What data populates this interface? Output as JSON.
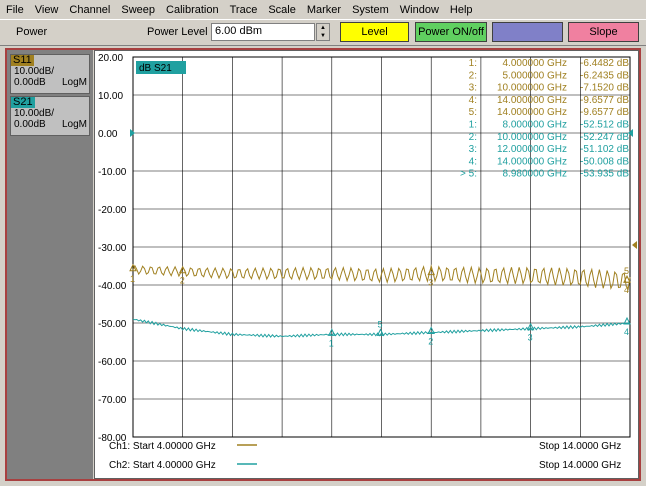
{
  "menu": [
    "File",
    "View",
    "Channel",
    "Sweep",
    "Calibration",
    "Trace",
    "Scale",
    "Marker",
    "System",
    "Window",
    "Help"
  ],
  "toolbar": {
    "mode": "Power",
    "power_label": "Power Level",
    "power_value": "6.00 dBm",
    "level_btn": "Level",
    "power_onoff_btn": "Power ON/off",
    "slope_btn": "Slope"
  },
  "colors": {
    "s11": "#a08020",
    "s21": "#20a0a0",
    "level": "#ffff00",
    "power": "#60d060",
    "blank": "#8080c8",
    "slope": "#f080a0"
  },
  "traces": [
    {
      "name": "S11",
      "scale": "10.00dB/",
      "ref": "0.00dB",
      "format": "LogM"
    },
    {
      "name": "S21",
      "scale": "10.00dB/",
      "ref": "0.00dB",
      "format": "LogM"
    }
  ],
  "plot": {
    "active_label": "dB S21",
    "y_ticks": [
      "20.00",
      "10.00",
      "0.00",
      "-10.00",
      "-20.00",
      "-30.00",
      "-40.00",
      "-50.00",
      "-60.00",
      "-70.00",
      "-80.00"
    ],
    "ylim": [
      -80,
      20
    ],
    "xlim": [
      4.0,
      14.0
    ]
  },
  "markers_s11": [
    {
      "id": "1:",
      "freq": "4.000000 GHz",
      "val": "-6.4482 dB"
    },
    {
      "id": "2:",
      "freq": "5.000000 GHz",
      "val": "-6.2435 dB"
    },
    {
      "id": "3:",
      "freq": "10.000000 GHz",
      "val": "-7.1520 dB"
    },
    {
      "id": "4:",
      "freq": "14.000000 GHz",
      "val": "-9.6577 dB"
    },
    {
      "id": "5:",
      "freq": "14.000000 GHz",
      "val": "-9.6577 dB"
    }
  ],
  "markers_s21": [
    {
      "id": "1:",
      "freq": "8.000000 GHz",
      "val": "-52.512 dB"
    },
    {
      "id": "2:",
      "freq": "10.000000 GHz",
      "val": "-52.247 dB"
    },
    {
      "id": "3:",
      "freq": "12.000000 GHz",
      "val": "-51.102 dB"
    },
    {
      "id": "4:",
      "freq": "14.000000 GHz",
      "val": "-50.008 dB"
    },
    {
      "id": "> 5:",
      "freq": "8.980000 GHz",
      "val": "-53.935 dB"
    }
  ],
  "chart_data": {
    "type": "line",
    "x_unit": "GHz",
    "ylim": [
      -80,
      20
    ],
    "xlim": [
      4.0,
      14.0
    ],
    "series": [
      {
        "name": "S11",
        "x": [
          4,
          5,
          6,
          7,
          8,
          9,
          10,
          11,
          12,
          13,
          14
        ],
        "values": [
          -36,
          -36.5,
          -37,
          -37,
          -37,
          -37.5,
          -37,
          -37.5,
          -37.5,
          -38,
          -39
        ]
      },
      {
        "name": "S21",
        "x": [
          4,
          5,
          6,
          7,
          8,
          9,
          10,
          11,
          12,
          13,
          14
        ],
        "values": [
          -49,
          -51.5,
          -53,
          -53.5,
          -53,
          -53,
          -52.5,
          -52,
          -51.5,
          -51,
          -50
        ]
      }
    ],
    "s11_markers": [
      {
        "label": "1",
        "x": 4.0
      },
      {
        "label": "2",
        "x": 5.0
      },
      {
        "label": "3",
        "x": 10.0
      },
      {
        "label": "4",
        "x": 14.0
      },
      {
        "label": "5",
        "x": 14.0
      }
    ],
    "s21_markers": [
      {
        "label": "1",
        "x": 8.0
      },
      {
        "label": "2",
        "x": 10.0
      },
      {
        "label": "3",
        "x": 12.0
      },
      {
        "label": "4",
        "x": 14.0
      },
      {
        "label": "5",
        "x": 8.98
      }
    ]
  },
  "footer": {
    "ch1_start": "Ch1: Start  4.00000 GHz",
    "ch1_stop": "Stop  14.0000 GHz",
    "ch2_start": "Ch2: Start  4.00000 GHz",
    "ch2_stop": "Stop  14.0000 GHz"
  }
}
